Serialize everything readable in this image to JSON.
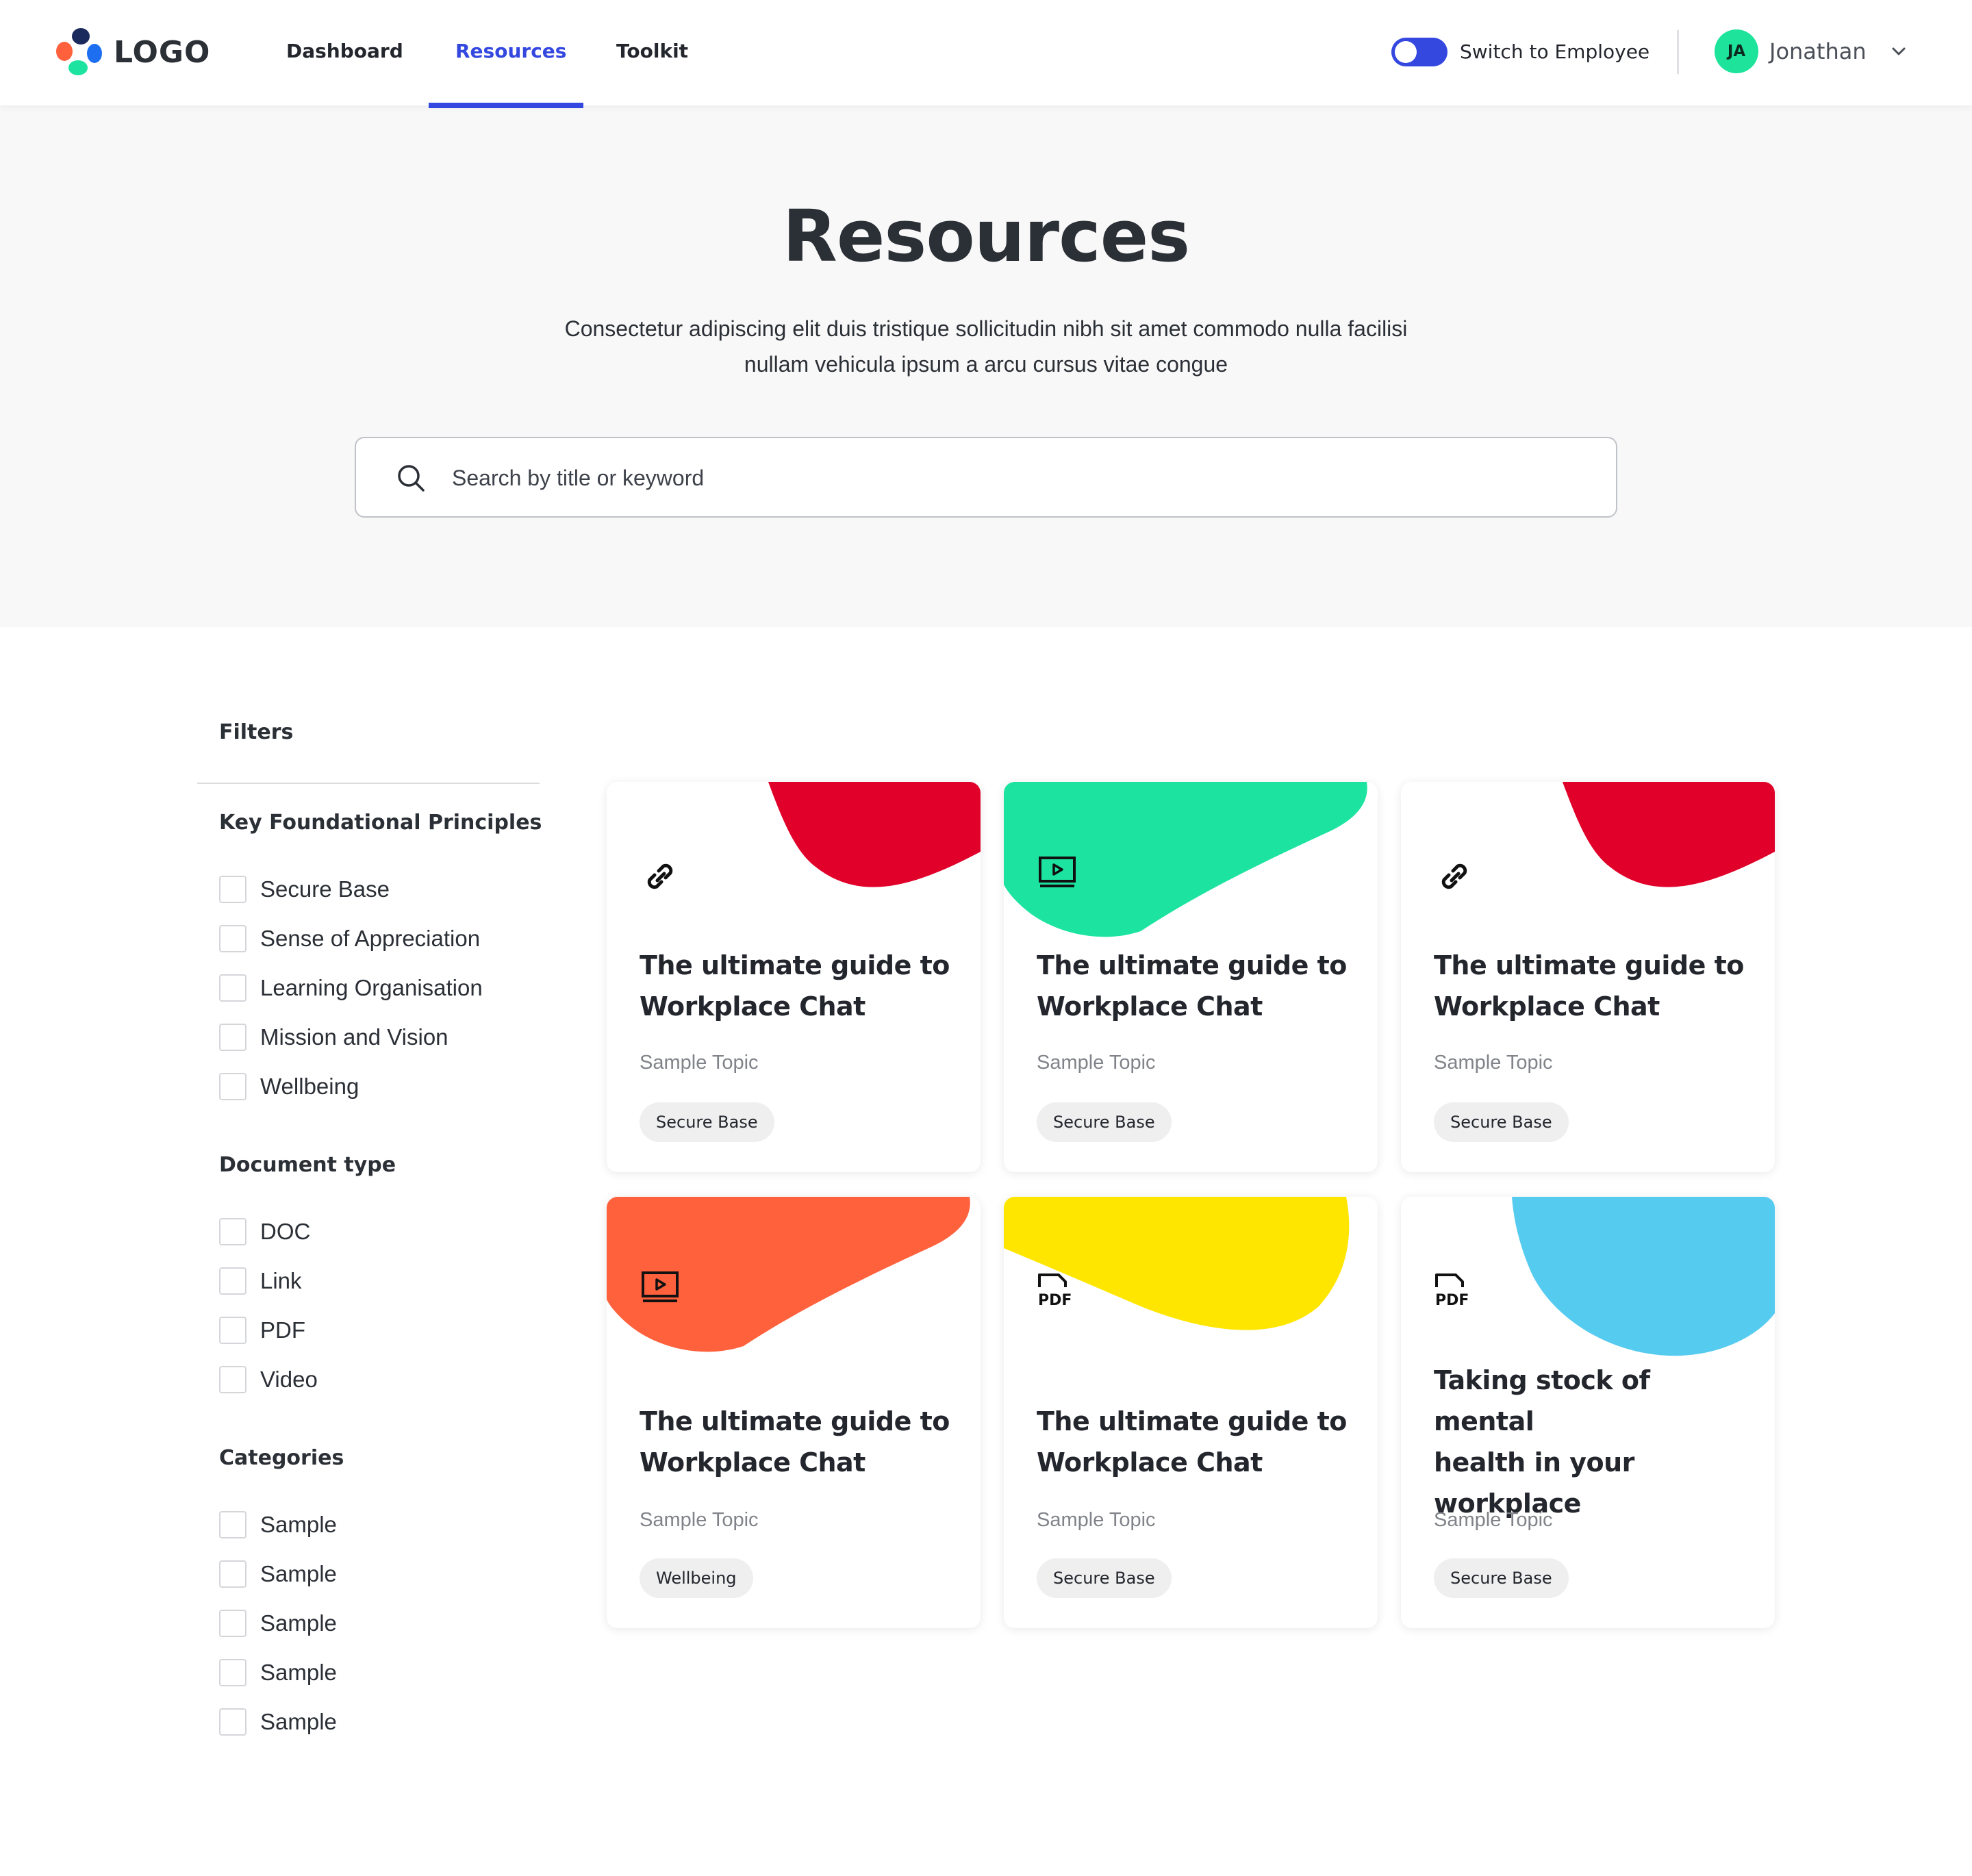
{
  "header": {
    "logo_text": "LOGO",
    "nav": [
      "Dashboard",
      "Resources",
      "Toolkit"
    ],
    "active_nav": "Resources",
    "switch_label": "Switch to Employee",
    "avatar_initials": "JA",
    "user_name": "Jonathan",
    "accent_color": "#3448e0"
  },
  "hero": {
    "title": "Resources",
    "description_line1": "Consectetur adipiscing elit duis tristique sollicitudin nibh sit amet commodo nulla facilisi",
    "description_line2": "nullam vehicula ipsum a arcu cursus vitae congue",
    "search_placeholder": "Search by title or keyword"
  },
  "filters": {
    "title": "Filters",
    "groups": [
      {
        "title": "Key Foundational Principles",
        "items": [
          "Secure Base",
          "Sense of Appreciation",
          "Learning Organisation",
          "Mission and Vision",
          "Wellbeing"
        ]
      },
      {
        "title": "Document type",
        "items": [
          "DOC",
          "Link",
          "PDF",
          "Video"
        ]
      },
      {
        "title": "Categories",
        "items": [
          "Sample",
          "Sample",
          "Sample",
          "Sample",
          "Sample"
        ]
      }
    ]
  },
  "cards": [
    {
      "icon": "link-icon",
      "title_line1": "The ultimate guide to",
      "title_line2": "Workplace Chat",
      "title_line3": "",
      "topic": "Sample Topic",
      "tag": "Secure Base",
      "color": "#e0002a"
    },
    {
      "icon": "video-icon",
      "title_line1": "The ultimate guide to",
      "title_line2": "Workplace Chat",
      "title_line3": "",
      "topic": "Sample Topic",
      "tag": "Secure Base",
      "color": "#1de3a0"
    },
    {
      "icon": "link-icon",
      "title_line1": "The ultimate guide to",
      "title_line2": "Workplace Chat",
      "title_line3": "",
      "topic": "Sample Topic",
      "tag": "Secure Base",
      "color": "#e0002a"
    },
    {
      "icon": "video-icon",
      "title_line1": "The ultimate guide to",
      "title_line2": "Workplace Chat",
      "title_line3": "",
      "topic": "Sample Topic",
      "tag": "Wellbeing",
      "color": "#ff613d"
    },
    {
      "icon": "pdf-icon",
      "title_line1": "The ultimate guide to",
      "title_line2": "Workplace Chat",
      "title_line3": "",
      "topic": "Sample Topic",
      "tag": "Secure Base",
      "color": "#ffe600"
    },
    {
      "icon": "pdf-icon",
      "title_line1": "Taking stock of mental",
      "title_line2": "health in your",
      "title_line3": "workplace",
      "topic": "Sample Topic",
      "tag": "Secure Base",
      "color": "#56cbf0"
    }
  ]
}
